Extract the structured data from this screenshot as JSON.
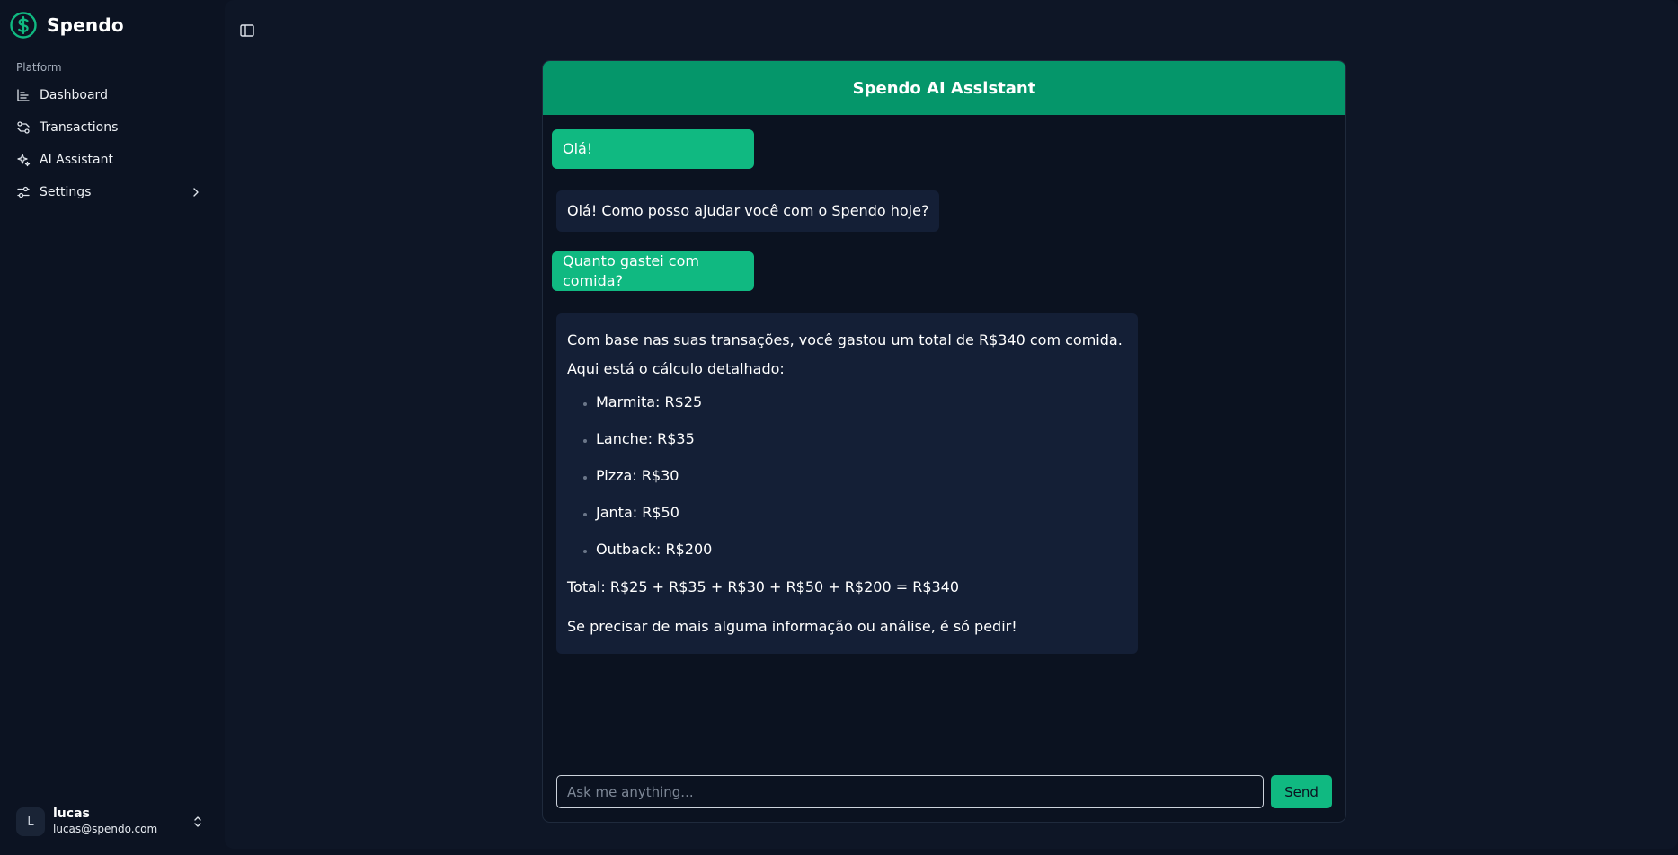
{
  "brand": {
    "name": "Spendo",
    "logo_icon": "dollar-circle-icon",
    "accent": "#10b981"
  },
  "sidebar": {
    "group_label": "Platform",
    "items": [
      {
        "label": "Dashboard",
        "icon": "bar-chart-icon"
      },
      {
        "label": "Transactions",
        "icon": "swap-icon"
      },
      {
        "label": "AI Assistant",
        "icon": "sparkles-icon"
      },
      {
        "label": "Settings",
        "icon": "sliders-icon",
        "has_submenu": true
      }
    ],
    "user": {
      "initial": "L",
      "name": "lucas",
      "email": "lucas@spendo.com"
    }
  },
  "chat": {
    "title": "Spendo AI Assistant",
    "messages": [
      {
        "role": "user",
        "text": "Olá!"
      },
      {
        "role": "assistant",
        "text": "Olá! Como posso ajudar você com o Spendo hoje?"
      },
      {
        "role": "user",
        "text": "Quanto gastei com comida?"
      },
      {
        "role": "assistant",
        "intro": "Com base nas suas transações, você gastou um total de R$340 com comida. Aqui está o cálculo detalhado:",
        "items": [
          "Marmita: R$25",
          "Lanche: R$35",
          "Pizza: R$30",
          "Janta: R$50",
          "Outback: R$200"
        ],
        "total": "Total: R$25 + R$35 + R$30 + R$50 + R$200 = R$340",
        "closing": "Se precisar de mais alguma informação ou análise, é só pedir!"
      }
    ],
    "input": {
      "placeholder": "Ask me anything...",
      "value": ""
    },
    "send_label": "Send"
  }
}
